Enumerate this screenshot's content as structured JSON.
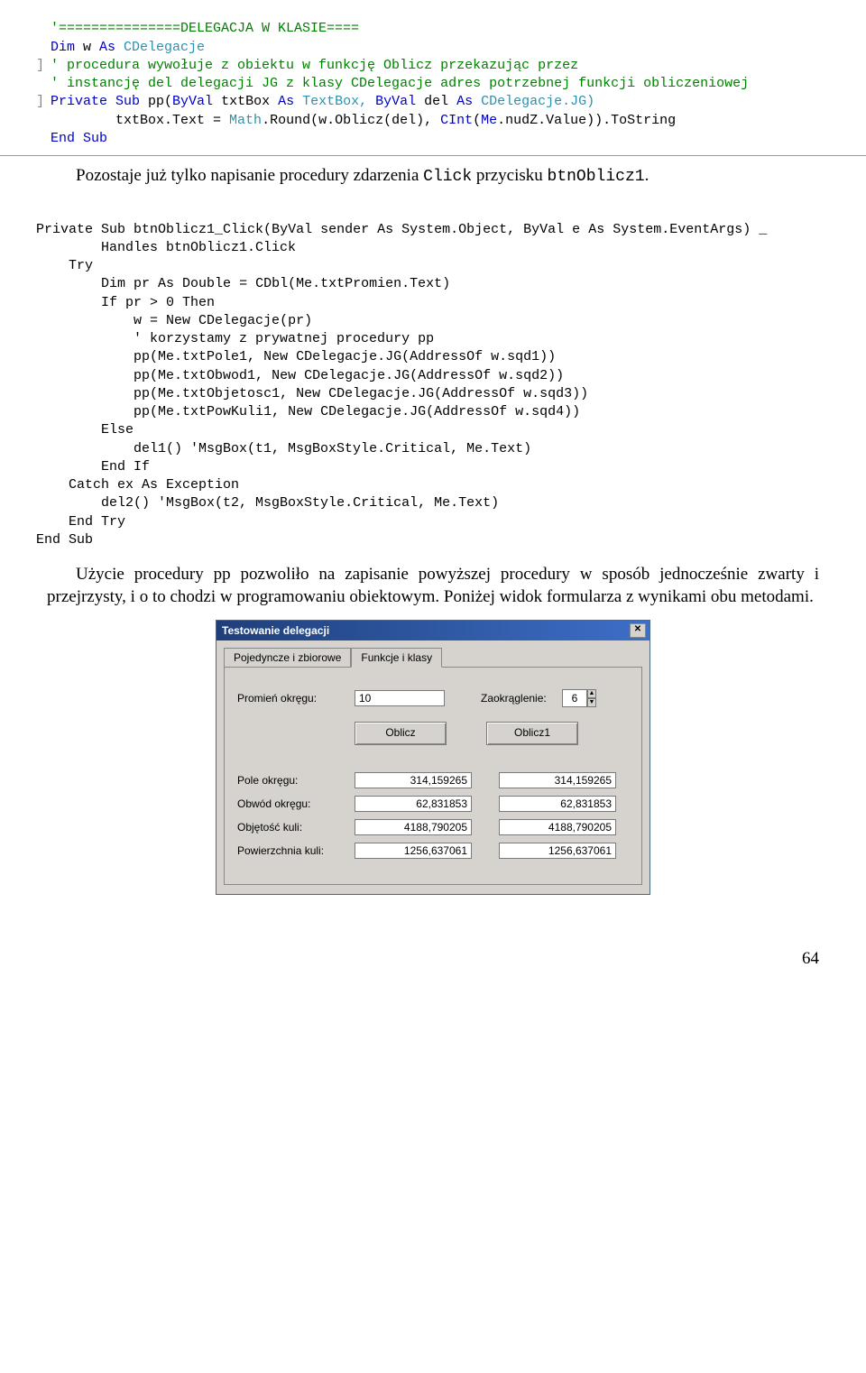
{
  "code1": {
    "l1": "'===============DELEGACJA W KLASIE====",
    "l2a": "Dim",
    "l2b": " w ",
    "l2c": "As",
    "l2d": " CDelegacje",
    "l3": "' procedura wywołuje z obiektu w funkcję Oblicz przekazując przez",
    "l4": "' instancję del delegacji JG z klasy CDelegacje adres potrzebnej funkcji obliczeniowej",
    "l5a": "Private Sub",
    "l5b": " pp(",
    "l5c": "ByVal",
    "l5d": " txtBox ",
    "l5e": "As",
    "l5f": " TextBox, ",
    "l5g": "ByVal",
    "l5h": " del ",
    "l5i": "As",
    "l5j": " CDelegacje.JG)",
    "l6a": "        txtBox.Text = ",
    "l6b": "Math",
    "l6c": ".Round(w.Oblicz(del), ",
    "l6d": "CInt",
    "l6e": "(",
    "l6f": "Me",
    "l6g": ".nudZ.Value)).ToString",
    "l7": "End Sub"
  },
  "para1_a": "Pozostaje już tylko napisanie procedury zdarzenia ",
  "para1_b": "Click",
  "para1_c": " przycisku ",
  "para1_d": "btnOblicz1",
  "para1_e": ".",
  "code2": {
    "a1a": "Private Sub",
    "a1b": " btnOblicz1_Click(",
    "a1c": "ByVal",
    "a1d": " sender ",
    "a1e": "As",
    "a1f": " System.",
    "a1g": "Object",
    "a1h": ", ",
    "a1i": "ByVal",
    "a1j": " e ",
    "a1k": "As",
    "a1l": " System.",
    "a1m": "EventArgs",
    "a1n": ") _",
    "a2a": "        Handles",
    "a2b": " btnOblicz1.Click",
    "a3": "    Try",
    "a4a": "        Dim",
    "a4b": " pr ",
    "a4c": "As Double",
    "a4d": " = ",
    "a4e": "CDbl",
    "a4f": "(",
    "a4g": "Me",
    "a4h": ".txtPromien.Text)",
    "a5a": "        If",
    "a5b": " pr > 0 ",
    "a5c": "Then",
    "a6a": "            w = ",
    "a6b": "New",
    "a6c": " CDelegacje(pr)",
    "a7": "            ' korzystamy z prywatnej procedury pp",
    "a8a": "            pp(",
    "a8b": "Me",
    "a8c": ".txtPole1, ",
    "a8d": "New",
    "a8e": " CDelegacje.JG(",
    "a8f": "AddressOf",
    "a8g": " w.sqd1))",
    "a9a": "            pp(",
    "a9b": "Me",
    "a9c": ".txtObwod1, ",
    "a9d": "New",
    "a9e": " CDelegacje.JG(",
    "a9f": "AddressOf",
    "a9g": " w.sqd2))",
    "a10a": "            pp(",
    "a10b": "Me",
    "a10c": ".txtObjetosc1, ",
    "a10d": "New",
    "a10e": " CDelegacje.JG(",
    "a10f": "AddressOf",
    "a10g": " w.sqd3))",
    "a11a": "            pp(",
    "a11b": "Me",
    "a11c": ".txtPowKuli1, ",
    "a11d": "New",
    "a11e": " CDelegacje.JG(",
    "a11f": "AddressOf",
    "a11g": " w.sqd4))",
    "a12": "        Else",
    "a13a": "            del1() ",
    "a13b": "'MsgBox(t1, MsgBoxStyle.Critical, Me.Text)",
    "a14": "        End If",
    "a15a": "    Catch",
    "a15b": " ex ",
    "a15c": "As",
    "a15d": " Exception",
    "a16a": "        del2() ",
    "a16b": "'MsgBox(t2, MsgBoxStyle.Critical, Me.Text)",
    "a17": "    End Try",
    "a18": "End Sub"
  },
  "para2": "Użycie procedury pp pozwoliło na zapisanie powyższej procedury w sposób jednocześnie zwarty i przejrzysty, i o to chodzi w programowaniu obiektowym. Poniżej widok formularza z wynikami obu metodami.",
  "form": {
    "title": "Testowanie delegacji",
    "tab1": "Pojedyncze i zbiorowe",
    "tab2": "Funkcje i klasy",
    "lab_promien": "Promień okręgu:",
    "val_promien": "10",
    "lab_zaokr": "Zaokrąglenie:",
    "val_zaokr": "6",
    "btn_oblicz": "Oblicz",
    "btn_oblicz1": "Oblicz1",
    "lab_pole": "Pole okręgu:",
    "lab_obwod": "Obwód okręgu:",
    "lab_obj": "Objętość kuli:",
    "lab_pow": "Powierzchnia kuli:",
    "v_pole_a": "314,159265",
    "v_pole_b": "314,159265",
    "v_obwod_a": "62,831853",
    "v_obwod_b": "62,831853",
    "v_obj_a": "4188,790205",
    "v_obj_b": "4188,790205",
    "v_pow_a": "1256,637061",
    "v_pow_b": "1256,637061"
  },
  "page_num": "64"
}
